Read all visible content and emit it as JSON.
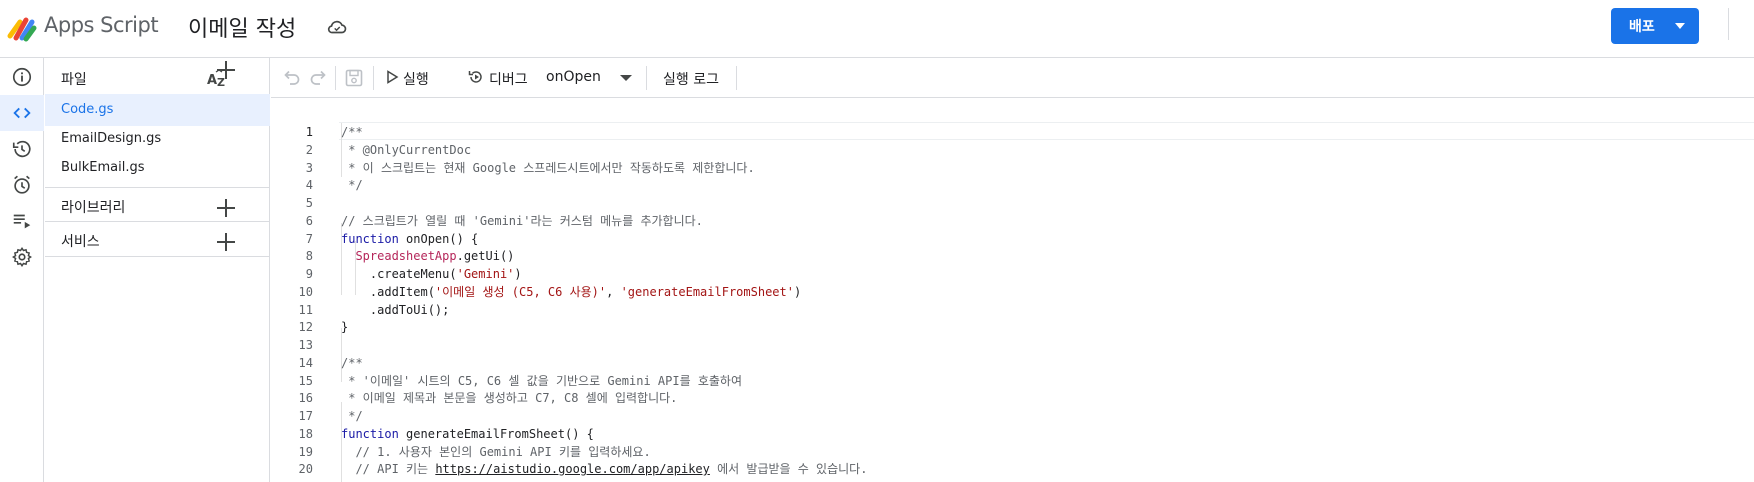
{
  "header": {
    "app_name": "Apps Script",
    "project_title": "이메일 작성",
    "deploy_label": "배포"
  },
  "rail": {
    "items": [
      "overview-icon",
      "editor-icon",
      "executions-icon",
      "triggers-icon",
      "executions-list-icon",
      "settings-icon"
    ],
    "active": "editor-icon"
  },
  "files_panel": {
    "files_label": "파일",
    "files": [
      {
        "name": "Code.gs",
        "active": true
      },
      {
        "name": "EmailDesign.gs",
        "active": false
      },
      {
        "name": "BulkEmail.gs",
        "active": false
      }
    ],
    "libraries_label": "라이브러리",
    "services_label": "서비스"
  },
  "toolbar": {
    "run_label": "실행",
    "debug_label": "디버그",
    "function_selected": "onOpen",
    "log_label": "실행 로그"
  },
  "editor": {
    "current_line": 1,
    "line_numbers": [
      "1",
      "2",
      "3",
      "4",
      "5",
      "6",
      "7",
      "8",
      "9",
      "10",
      "11",
      "12",
      "13",
      "14",
      "15",
      "16",
      "17",
      "18",
      "19",
      "20"
    ],
    "lines": [
      "/**",
      " * @OnlyCurrentDoc",
      " * 이 스크립트는 현재 Google 스프레드시트에서만 작동하도록 제한합니다.",
      " */",
      "",
      "// 스크립트가 열릴 때 'Gemini'라는 커스텀 메뉴를 추가합니다.",
      "function onOpen() {",
      "  SpreadsheetApp.getUi()",
      "    .createMenu('Gemini')",
      "    .addItem('이메일 생성 (C5, C6 사용)', 'generateEmailFromSheet')",
      "    .addToUi();",
      "}",
      "",
      "/**",
      " * '이메일' 시트의 C5, C6 셀 값을 기반으로 Gemini API를 호출하여",
      " * 이메일 제목과 본문을 생성하고 C7, C8 셀에 입력합니다.",
      " */",
      "function generateEmailFromSheet() {",
      "  // 1. 사용자 본인의 Gemini API 키를 입력하세요.",
      "  // API 키는 https://aistudio.google.com/app/apikey 에서 발급받을 수 있습니다."
    ]
  }
}
